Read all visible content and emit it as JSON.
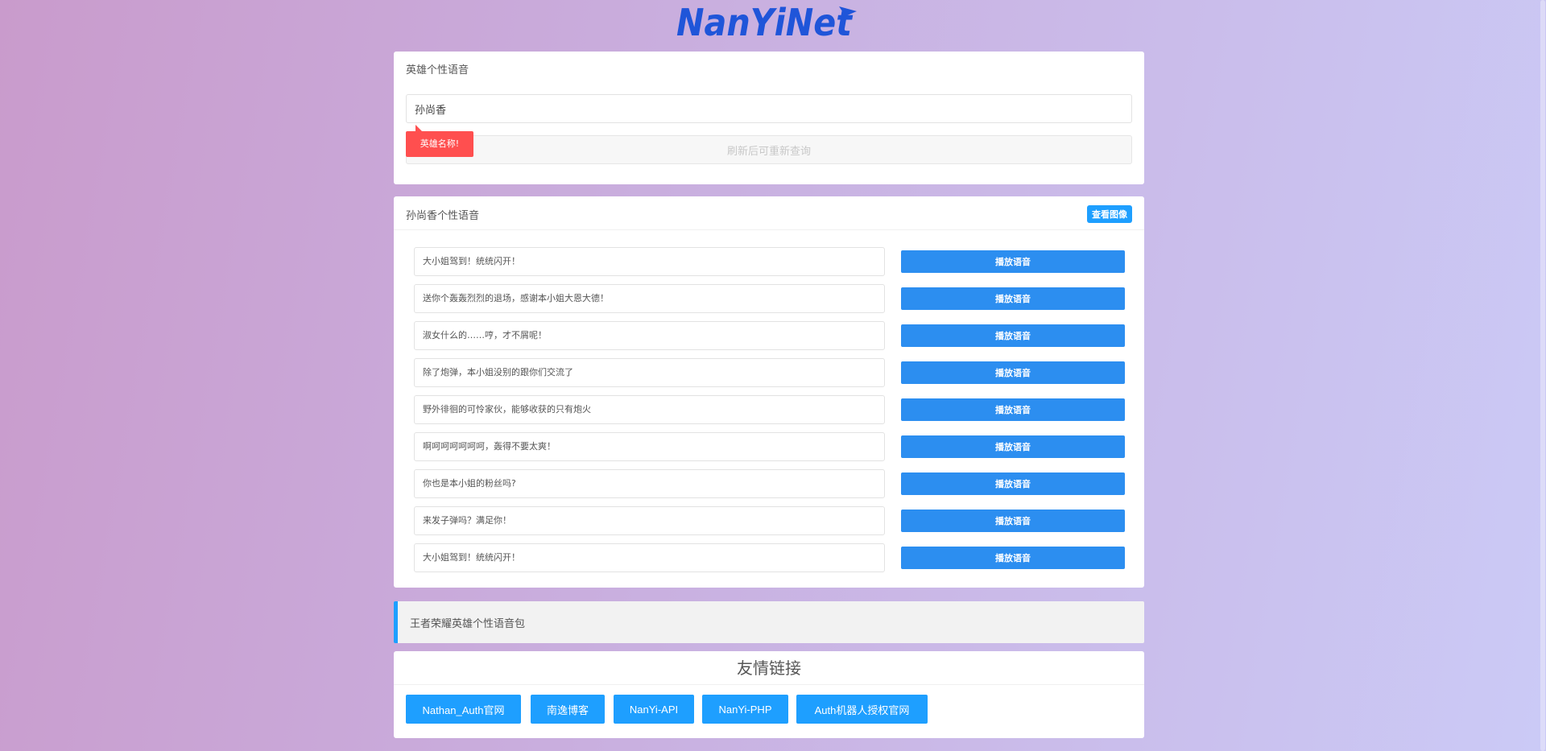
{
  "logo": {
    "text": "NanYiNet"
  },
  "search_card": {
    "title": "英雄个性语音",
    "input_value": "孙尚香",
    "query_button_label": "刷新后可重新查询",
    "tooltip": "英雄名称!"
  },
  "voices_card": {
    "title": "孙尚香个性语音",
    "view_image_label": "查看图像",
    "items": [
      {
        "text": "大小姐驾到！统统闪开！",
        "button": "播放语音"
      },
      {
        "text": "送你个轰轰烈烈的退场，感谢本小姐大恩大德！",
        "button": "播放语音"
      },
      {
        "text": "淑女什么的……哼，才不屑呢！",
        "button": "播放语音"
      },
      {
        "text": "除了炮弹，本小姐没别的跟你们交流了",
        "button": "播放语音"
      },
      {
        "text": "野外徘徊的可怜家伙，能够收获的只有炮火",
        "button": "播放语音"
      },
      {
        "text": "啊呵呵呵呵呵呵，轰得不要太爽！",
        "button": "播放语音"
      },
      {
        "text": "你也是本小姐的粉丝吗?",
        "button": "播放语音"
      },
      {
        "text": "来发子弹吗？满足你！",
        "button": "播放语音"
      },
      {
        "text": "大小姐驾到！统统闪开！",
        "button": "播放语音"
      }
    ]
  },
  "banner": {
    "text": "王者荣耀英雄个性语音包"
  },
  "links_card": {
    "title": "友情链接",
    "links": [
      "Nathan_Auth官网",
      "南逸博客",
      "NanYi-API",
      "NanYi-PHP",
      "Auth机器人授权官网"
    ]
  },
  "colors": {
    "accent": "#1e9fff",
    "play_button": "#2c8ef0",
    "tooltip": "#ff4f4f",
    "logo": "#1f55d9"
  }
}
